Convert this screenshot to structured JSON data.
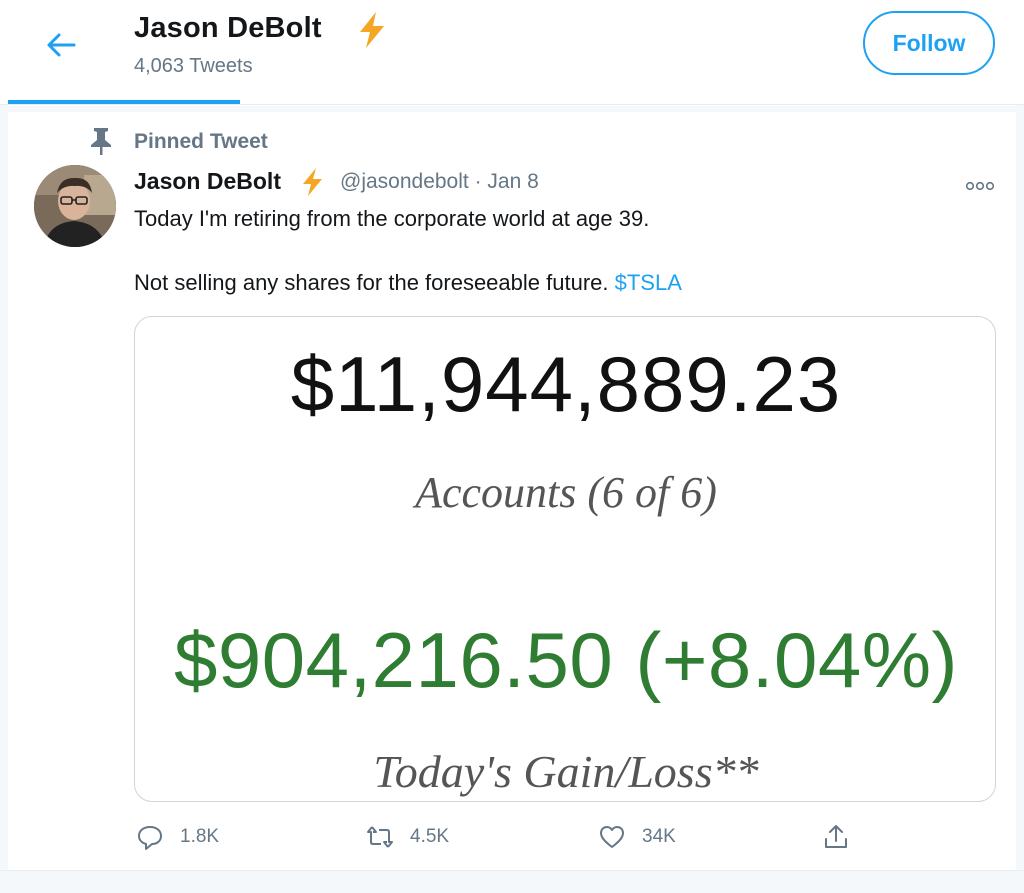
{
  "header": {
    "name": "Jason DeBolt",
    "tweet_count": "4,063 Tweets",
    "follow_label": "Follow"
  },
  "pinned": {
    "label": "Pinned Tweet"
  },
  "tweet": {
    "author_name": "Jason DeBolt",
    "handle_date": "@jasondebolt · Jan 8",
    "line1": "Today I'm retiring from the corporate world at age 39.",
    "line2_text": "Not selling any shares for the foreseeable future. ",
    "cashtag": "$TSLA"
  },
  "media": {
    "total_value": "$11,944,889.23",
    "accounts_label": "Accounts (6 of 6)",
    "gain_value": "$904,216.50 (+8.04%)",
    "gain_label": "Today's Gain/Loss**"
  },
  "actions": {
    "replies": "1.8K",
    "retweets": "4.5K",
    "likes": "34K"
  },
  "colors": {
    "accent": "#1da1f2",
    "bolt": "#f5a623",
    "gain_green": "#2e7d32",
    "muted": "#657786"
  },
  "icons": [
    "back-arrow-icon",
    "lightning-bolt-icon",
    "pin-icon",
    "more-icon",
    "reply-icon",
    "retweet-icon",
    "like-icon",
    "share-icon"
  ]
}
